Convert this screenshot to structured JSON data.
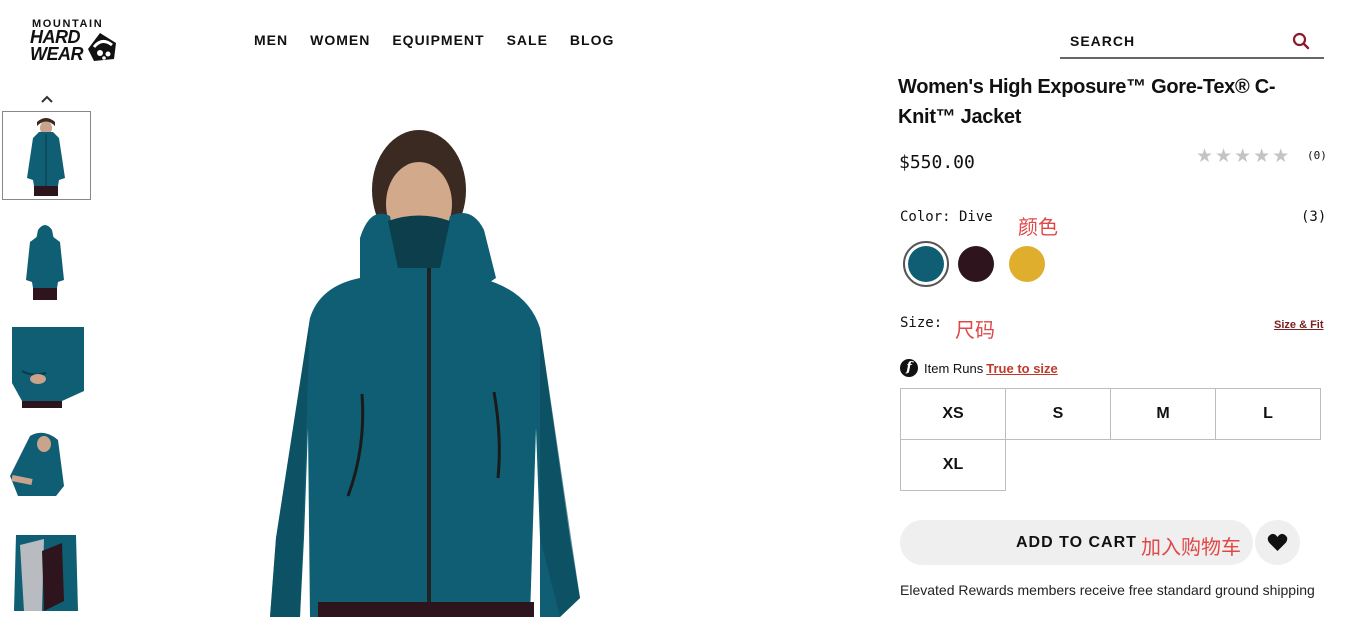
{
  "brand": {
    "line1": "MOUNTAIN",
    "line2": "HARD",
    "line3": "WEAR"
  },
  "nav": [
    "MEN",
    "WOMEN",
    "EQUIPMENT",
    "SALE",
    "BLOG"
  ],
  "search": {
    "placeholder": "SEARCH",
    "icon": "search-icon"
  },
  "product": {
    "title": "Women's High Exposure™ Gore-Tex® C-Knit™ Jacket",
    "price": "$550.00",
    "rating": {
      "stars_filled": 0,
      "stars_total": 5,
      "count_text": "(0)"
    },
    "color_label": "Color: Dive",
    "color_count": "(3)",
    "colors": [
      {
        "name": "Dive",
        "hex": "#0f5e74",
        "selected": true
      },
      {
        "name": "dark-plum",
        "hex": "#2e141c",
        "selected": false
      },
      {
        "name": "gold",
        "hex": "#dfae2c",
        "selected": false
      }
    ],
    "size_label": "Size:",
    "size_fit_link": "Size & Fit",
    "item_runs": "Item Runs",
    "true_to_size": "True to size",
    "sizes": [
      "XS",
      "S",
      "M",
      "L",
      "XL"
    ],
    "add_to_cart": "ADD TO CART",
    "rewards_text": "Elevated Rewards members receive free standard ground shipping"
  },
  "annotations": {
    "color": "颜色",
    "size": "尺码",
    "cart": "加入购物车"
  },
  "thumbnails": [
    "front",
    "back",
    "detail-pocket",
    "side-hood",
    "open-lining"
  ],
  "colors": {
    "teal": "#0f5e74",
    "link_red": "#c0392b",
    "brand_red": "#8b1a2b",
    "annotation": "#e04848"
  }
}
